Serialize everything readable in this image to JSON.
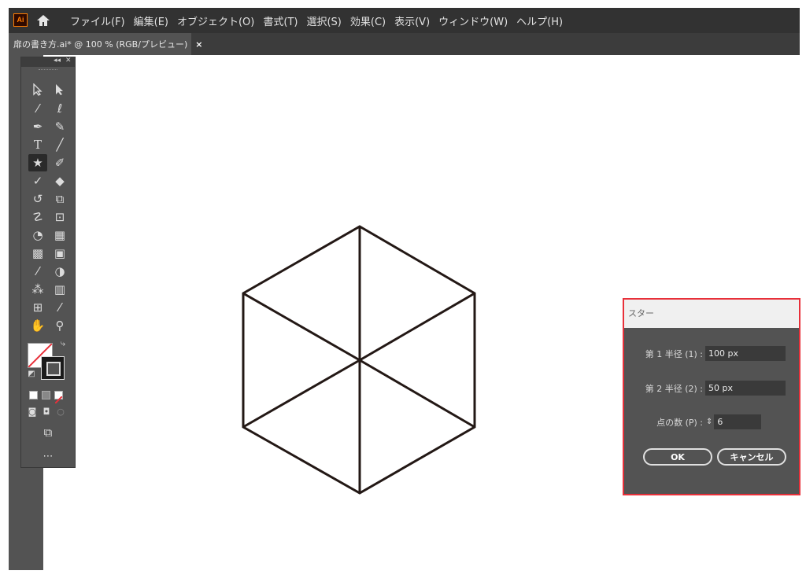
{
  "app": {
    "logo_text": "Ai",
    "menu": [
      "ファイル(F)",
      "編集(E)",
      "オブジェクト(O)",
      "書式(T)",
      "選択(S)",
      "効果(C)",
      "表示(V)",
      "ウィンドウ(W)",
      "ヘルプ(H)"
    ]
  },
  "document_tab": {
    "label": "扉の書き方.ai* @ 100 % (RGB/プレビュー)",
    "close": "×"
  },
  "toolbar": {
    "tools": [
      "selection",
      "direct-selection",
      "magic-wand",
      "lasso",
      "pen",
      "curvature",
      "type",
      "line-segment",
      "star",
      "paintbrush",
      "shaper",
      "eraser",
      "rotate",
      "scale",
      "puppet-warp",
      "free-transform",
      "shape-builder",
      "perspective-grid",
      "mesh",
      "gradient",
      "eyedropper",
      "blend",
      "symbol-sprayer",
      "column-graph",
      "artboard",
      "slice",
      "hand",
      "zoom"
    ],
    "selected_tool": "star",
    "more_label": "⋯"
  },
  "dialog": {
    "title": "スター",
    "radius1_label": "第 1 半径 (1) :",
    "radius1_value": "100 px",
    "radius2_label": "第 2 半径 (2) :",
    "radius2_value": "50 px",
    "points_label": "点の数 (P) :",
    "points_value": "6",
    "ok_label": "OK",
    "cancel_label": "キャンセル"
  },
  "colors": {
    "menubar": "#323232",
    "workspace": "#535353",
    "dialog_highlight": "#e8303a",
    "brand": "#ff7c00"
  }
}
